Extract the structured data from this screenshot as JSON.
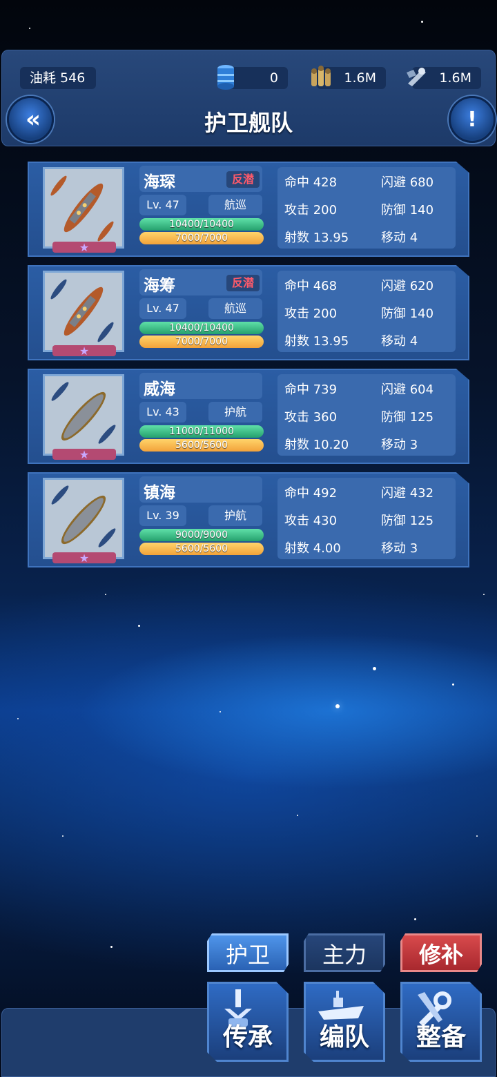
{
  "resources": {
    "oil_label": "油耗 546",
    "barrel_value": "0",
    "shells_value": "1.6M",
    "parts_value": "1.6M"
  },
  "header": {
    "title": "护卫舰队",
    "back_icon": "double-chevron-left-icon",
    "info_icon": "exclamation-icon"
  },
  "ships": [
    {
      "name": "海琛",
      "tag": "反潜",
      "level": "Lv.  47",
      "role": "航巡",
      "hp": "10400/10400",
      "fuel": "7000/7000",
      "stats": {
        "hit": "命中 428",
        "evade": "闪避 680",
        "attack": "攻击 200",
        "defense": "防御 140",
        "range": "射数 13.95",
        "move": "移动 4"
      }
    },
    {
      "name": "海筹",
      "tag": "反潜",
      "level": "Lv.  47",
      "role": "航巡",
      "hp": "10400/10400",
      "fuel": "7000/7000",
      "stats": {
        "hit": "命中 468",
        "evade": "闪避 620",
        "attack": "攻击 200",
        "defense": "防御 140",
        "range": "射数 13.95",
        "move": "移动 4"
      }
    },
    {
      "name": "威海",
      "tag": "",
      "level": "Lv.  43",
      "role": "护航",
      "hp": "11000/11000",
      "fuel": "5600/5600",
      "stats": {
        "hit": "命中 739",
        "evade": "闪避 604",
        "attack": "攻击 360",
        "defense": "防御 125",
        "range": "射数 10.20",
        "move": "移动 3"
      }
    },
    {
      "name": "镇海",
      "tag": "",
      "level": "Lv.  39",
      "role": "护航",
      "hp": "9000/9000",
      "fuel": "5600/5600",
      "stats": {
        "hit": "命中 492",
        "evade": "闪避 432",
        "attack": "攻击 430",
        "defense": "防御 125",
        "range": "射数 4.00",
        "move": "移动 3"
      }
    }
  ],
  "tabs": {
    "escort": "护卫",
    "main": "主力",
    "repair": "修补"
  },
  "actions": {
    "inherit": "传承",
    "formation": "编队",
    "maintain": "整备"
  },
  "colors": {
    "accent": "#2f6bc4",
    "hp_bar": "#25a06d",
    "fuel_bar": "#f2a23a",
    "tag_text": "#ff5a6a",
    "repair_tab": "#c0383c"
  }
}
